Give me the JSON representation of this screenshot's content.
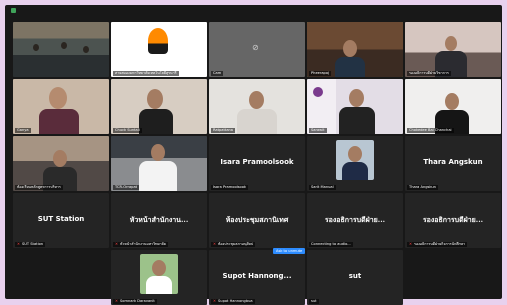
{
  "tiles": [
    {
      "name": "",
      "kind": "video"
    },
    {
      "name": "สายสมองมหาวิทยาลัยเทคโนโลยีสุรนารี",
      "kind": "logo"
    },
    {
      "name": "Cam",
      "kind": "camoff"
    },
    {
      "name": "Pheerapoj",
      "kind": "video"
    },
    {
      "name": "รองอธิการบดีฝ่ายวิชาการ",
      "kind": "video"
    },
    {
      "name": "Ganya",
      "kind": "video"
    },
    {
      "name": "Chuck Suntali",
      "kind": "video"
    },
    {
      "name": "Ratpattana",
      "kind": "video"
    },
    {
      "name": "Sarawit",
      "kind": "video"
    },
    {
      "name": "Chokedee Bai Chanchai",
      "kind": "video"
    },
    {
      "name": "ห้องเรียนหลักสูตรการบริหาร",
      "kind": "video"
    },
    {
      "name": "TCR-Orrapat",
      "kind": "video"
    },
    {
      "name": "Isara Pramoolsook",
      "kind": "text",
      "label": "Isara Pramoolsook"
    },
    {
      "name": "Sarit Manual",
      "kind": "avatar"
    },
    {
      "name": "Thara Angskun",
      "kind": "text",
      "label": "Thara Angskun"
    },
    {
      "name": "SUT Station",
      "kind": "text",
      "label": "SUT Station"
    },
    {
      "name": "หัวหน้าสำนักงานมหาวิทยาลัย",
      "kind": "text",
      "label": "หัวหน้าสำนักงาน..."
    },
    {
      "name": "ห้องประชุมสภาอนุศิลป",
      "kind": "text",
      "label": "ห้องประชุมสภานิเทศ"
    },
    {
      "name": "Connecting to audio...",
      "kind": "text",
      "label": "รองอธิการบดีฝ่าย..."
    },
    {
      "name": "รองอธิการบดีฝ่ายกิจการนักศึกษา",
      "kind": "text",
      "label": "รองอธิการบดีฝ่าย..."
    },
    {
      "name": "Somnark Daravanit",
      "kind": "avatar"
    },
    {
      "name": "Supot Hannongbua",
      "kind": "text",
      "label": "Supot Hannong..."
    },
    {
      "name": "sut",
      "kind": "text",
      "label": "sut"
    }
  ],
  "unmute_label": "Ask to unmute",
  "colors": {
    "background": "#e8d1ee",
    "meeting": "#181818",
    "tile": "#242424",
    "active_speaker": "#7fd36b"
  }
}
